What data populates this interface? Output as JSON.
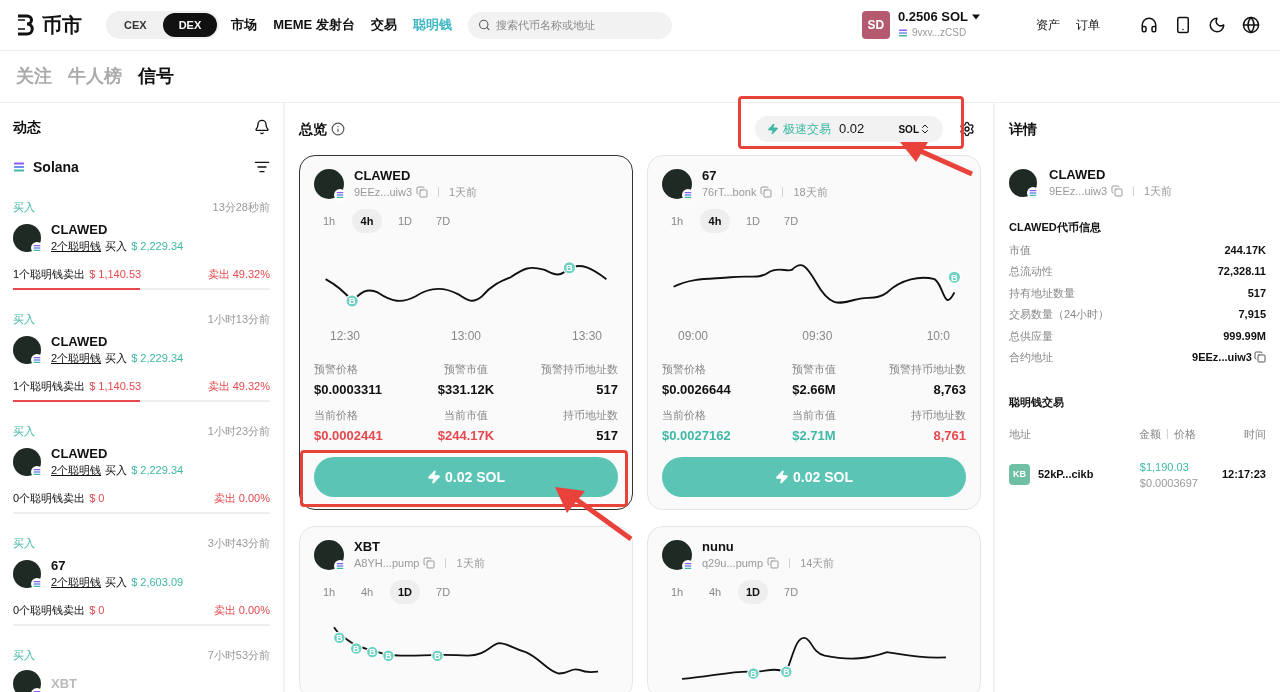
{
  "header": {
    "logo_text": "币市",
    "market_switch": [
      {
        "label": "CEX",
        "selected": false
      },
      {
        "label": "DEX",
        "selected": true
      }
    ],
    "nav": [
      {
        "label": "市场",
        "selected": false
      },
      {
        "label": "MEME 发射台",
        "selected": false
      },
      {
        "label": "交易",
        "selected": false
      },
      {
        "label": "聪明钱",
        "selected": true
      }
    ],
    "search": {
      "placeholder": "搜索代币名称或地址"
    },
    "account": {
      "initials": "SD",
      "balance": "0.2506 SOL",
      "address": "9vxv...zCSD"
    },
    "links": [
      "资产",
      "订单"
    ]
  },
  "page_tabs": [
    {
      "label": "关注",
      "selected": false
    },
    {
      "label": "牛人榜",
      "selected": false
    },
    {
      "label": "信号",
      "selected": true
    }
  ],
  "feed": {
    "title": "动态",
    "chain": "Solana",
    "items": [
      {
        "tag": "买入",
        "time": "13分28秒前",
        "name": "CLAWED",
        "buyers": "2个聪明钱",
        "buy_word": "买入",
        "buy_amount": "$ 2,229.34",
        "sellers": "1个聪明钱卖出",
        "sell_amount": "$ 1,140.53",
        "sell_ratio": "卖出 49.32%",
        "level": 0.4932
      },
      {
        "tag": "买入",
        "time": "1小时13分前",
        "name": "CLAWED",
        "buyers": "2个聪明钱",
        "buy_word": "买入",
        "buy_amount": "$ 2,229.34",
        "sellers": "1个聪明钱卖出",
        "sell_amount": "$ 1,140.53",
        "sell_ratio": "卖出 49.32%",
        "level": 0.4932
      },
      {
        "tag": "买入",
        "time": "1小时23分前",
        "name": "CLAWED",
        "buyers": "2个聪明钱",
        "buy_word": "买入",
        "buy_amount": "$ 2,229.34",
        "sellers": "0个聪明钱卖出",
        "sell_amount": "$ 0",
        "sell_ratio": "卖出 0.00%",
        "level": 0
      },
      {
        "tag": "买入",
        "time": "3小时43分前",
        "name": "67",
        "buyers": "2个聪明钱",
        "buy_word": "买入",
        "buy_amount": "$ 2,603.09",
        "sellers": "0个聪明钱卖出",
        "sell_amount": "$ 0",
        "sell_ratio": "卖出 0.00%",
        "level": 0
      },
      {
        "tag": "买入",
        "time": "7小时53分前",
        "name": "XBT"
      }
    ]
  },
  "overview": {
    "title": "总览",
    "quick_trade": {
      "label": "极速交易",
      "value": "0.02",
      "unit": "SOL"
    },
    "cards": [
      {
        "selected": true,
        "name": "CLAWED",
        "address": "9EEz...uiw3",
        "age": "1天前",
        "timeframes": [
          {
            "label": "1h",
            "selected": false
          },
          {
            "label": "4h",
            "selected": true
          },
          {
            "label": "1D",
            "selected": false
          },
          {
            "label": "7D",
            "selected": false
          }
        ],
        "markers": [
          "B",
          "B"
        ],
        "time_labels": [
          "12:30",
          "13:00",
          "13:30"
        ],
        "alert": [
          {
            "label": "预警价格",
            "value": "$0.0003311"
          },
          {
            "label": "预警市值",
            "value": "$331.12K"
          },
          {
            "label": "预警持币地址数",
            "value": "517"
          }
        ],
        "current": [
          {
            "label": "当前价格",
            "value": "$0.0002441",
            "color": "#e5484d"
          },
          {
            "label": "当前市值",
            "value": "$244.17K",
            "color": "#e5484d"
          },
          {
            "label": "持币地址数",
            "value": "517",
            "color": "#111111"
          }
        ],
        "button": "0.02 SOL"
      },
      {
        "selected": false,
        "name": "67",
        "address": "76rT...bonk",
        "age": "18天前",
        "timeframes": [
          {
            "label": "1h",
            "selected": false
          },
          {
            "label": "4h",
            "selected": true
          },
          {
            "label": "1D",
            "selected": false
          },
          {
            "label": "7D",
            "selected": false
          }
        ],
        "markers": [
          "B"
        ],
        "time_labels": [
          "09:00",
          "09:30",
          "10:0"
        ],
        "alert": [
          {
            "label": "预警价格",
            "value": "$0.0026644"
          },
          {
            "label": "预警市值",
            "value": "$2.66M"
          },
          {
            "label": "预警持币地址数",
            "value": "8,763"
          }
        ],
        "current": [
          {
            "label": "当前价格",
            "value": "$0.0027162",
            "color": "#3fb8a6"
          },
          {
            "label": "当前市值",
            "value": "$2.71M",
            "color": "#3fb8a6"
          },
          {
            "label": "持币地址数",
            "value": "8,761",
            "color": "#e5484d"
          }
        ],
        "button": "0.02 SOL"
      },
      {
        "selected": false,
        "name": "XBT",
        "address": "A8YH...pump",
        "age": "1天前",
        "timeframes": [
          {
            "label": "1h",
            "selected": false
          },
          {
            "label": "4h",
            "selected": false
          },
          {
            "label": "1D",
            "selected": true
          },
          {
            "label": "7D",
            "selected": false
          }
        ],
        "markers": [
          "B",
          "B",
          "B",
          "B",
          "B"
        ]
      },
      {
        "selected": false,
        "name": "nunu",
        "address": "q29u...pump",
        "age": "14天前",
        "timeframes": [
          {
            "label": "1h",
            "selected": false
          },
          {
            "label": "4h",
            "selected": false
          },
          {
            "label": "1D",
            "selected": true
          },
          {
            "label": "7D",
            "selected": false
          }
        ],
        "markers": [
          "B",
          "B"
        ]
      }
    ]
  },
  "details": {
    "title": "详情",
    "name": "CLAWED",
    "address": "9EEz...uiw3",
    "age": "1天前",
    "info_title": "CLAWED代币信息",
    "info": [
      {
        "label": "市值",
        "value": "244.17K"
      },
      {
        "label": "总流动性",
        "value": "72,328.11"
      },
      {
        "label": "持有地址数量",
        "value": "517"
      },
      {
        "label": "交易数量（24小时）",
        "value": "7,915"
      },
      {
        "label": "总供应量",
        "value": "999.99M"
      },
      {
        "label": "合约地址",
        "value": "9EEz...uiw3",
        "kind": "copy"
      }
    ],
    "trades_title": "聪明钱交易",
    "trade_columns": [
      "地址",
      "金额",
      "价格",
      "时间"
    ],
    "trades": [
      {
        "initials": "KB",
        "address": "52kP...cikb",
        "amount": "$1,190.03",
        "price": "$0.0003697",
        "time": "12:17:23"
      }
    ]
  }
}
